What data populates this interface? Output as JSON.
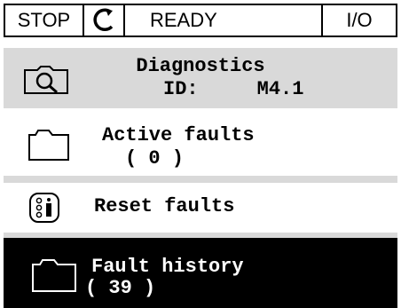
{
  "status_bar": {
    "stop_label": "STOP",
    "rotation_icon": "rotate-ccw-icon",
    "state_label": "READY",
    "io_label": "I/O"
  },
  "header": {
    "icon": "magnifier-icon",
    "title": "Diagnostics",
    "id_label": "ID:",
    "id_value": "M4.1"
  },
  "menu": {
    "items": [
      {
        "label": "Active faults",
        "count": "( 0 )",
        "icon": "folder-icon"
      },
      {
        "label": "Reset faults",
        "icon": "reset-parameter-icon"
      },
      {
        "label": "Fault history",
        "count": "( 39 )",
        "icon": "folder-icon",
        "selected": true
      }
    ]
  },
  "colors": {
    "header_bg": "#d9d9d9",
    "selected_bg": "#000000",
    "selected_fg": "#ffffff",
    "text": "#000000"
  }
}
